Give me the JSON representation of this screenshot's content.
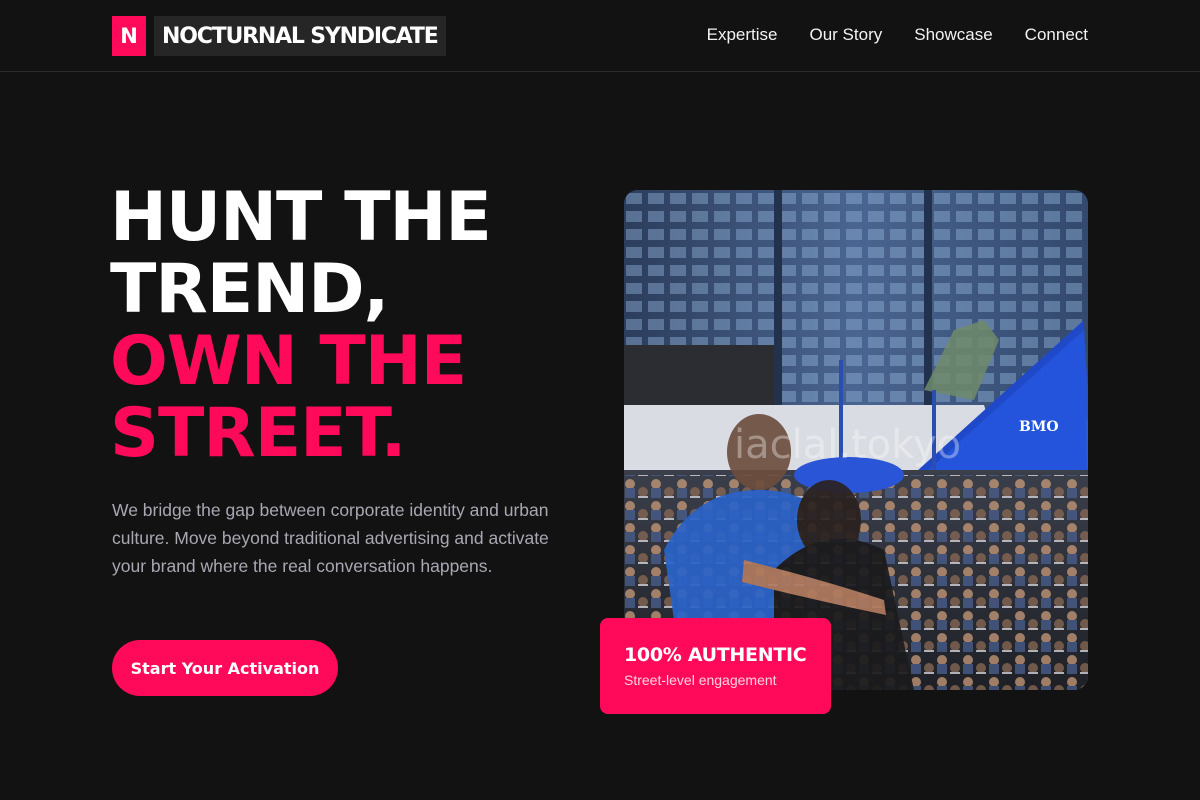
{
  "brand": {
    "mark": "N",
    "name": "NOCTURNAL SYNDICATE"
  },
  "nav": {
    "items": [
      {
        "label": "Expertise"
      },
      {
        "label": "Our Story"
      },
      {
        "label": "Showcase"
      },
      {
        "label": "Connect"
      }
    ]
  },
  "hero": {
    "title_line1": "HUNT THE",
    "title_line2": "TREND,",
    "title_line3": "OWN THE",
    "title_line4": "STREET.",
    "description": "We bridge the gap between corporate identity and urban culture. Move beyond traditional advertising and activate your brand where the real conversation happens.",
    "cta_label": "Start Your Activation"
  },
  "photo": {
    "description_icon": "street-crowd-photo",
    "tent_text": "BMO",
    "watermark": "iaclal.tokyo"
  },
  "badge": {
    "title": "100% AUTHENTIC",
    "subtitle": "Street-level engagement"
  },
  "colors": {
    "background": "#121212",
    "accent": "#ff0a5a",
    "text_muted": "#a8a8b3"
  }
}
